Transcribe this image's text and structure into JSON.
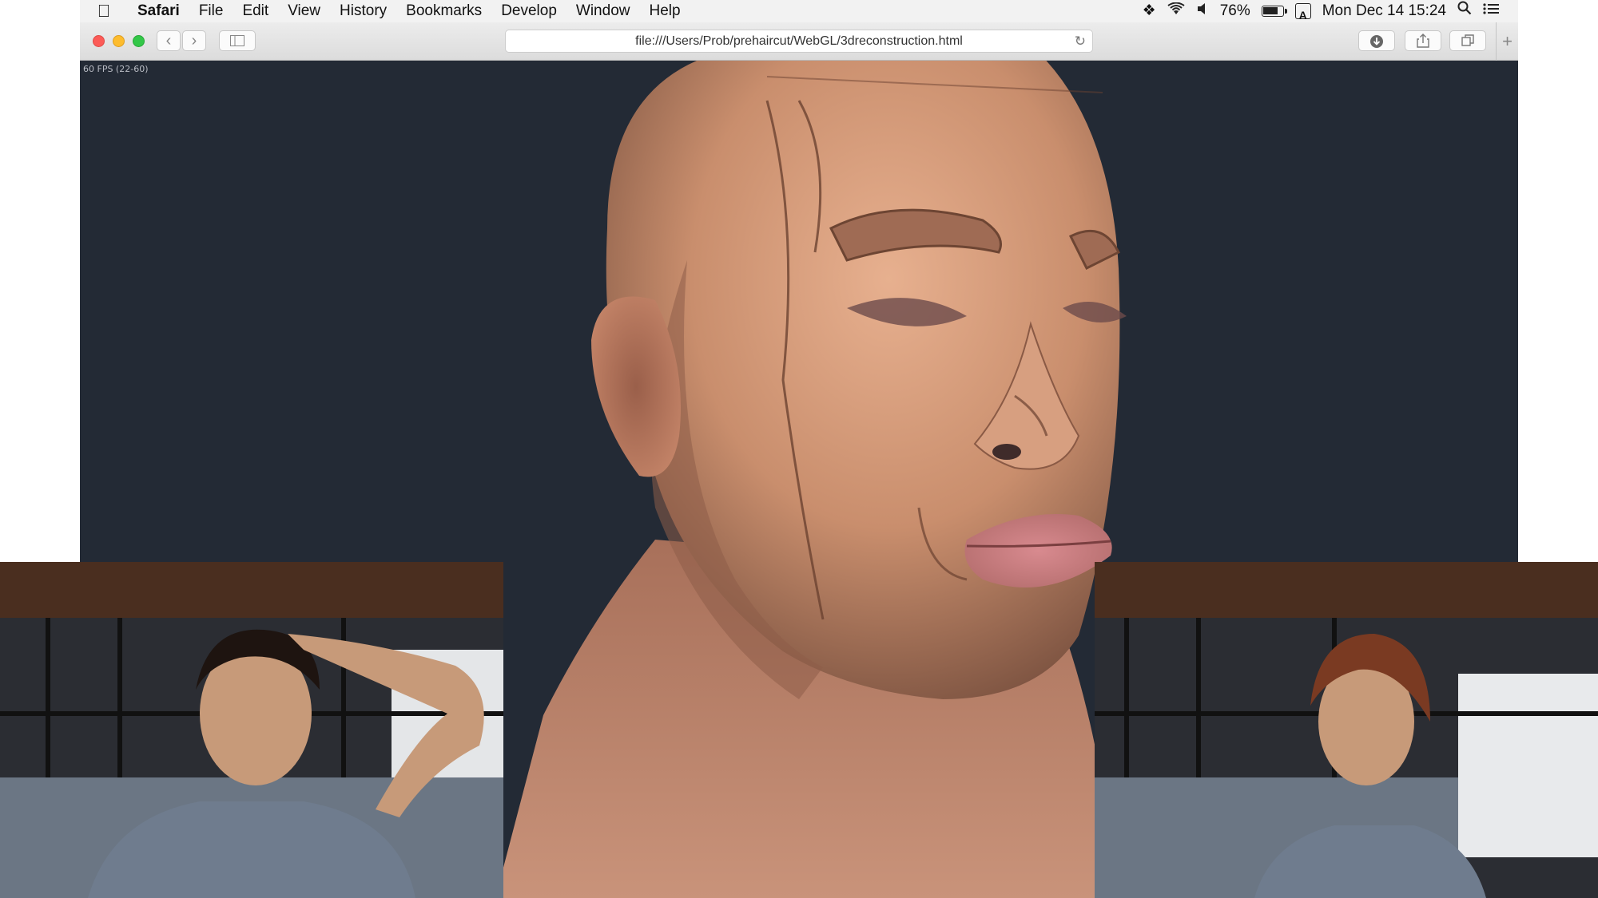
{
  "menubar": {
    "app_name": "Safari",
    "menus": [
      "File",
      "Edit",
      "View",
      "History",
      "Bookmarks",
      "Develop",
      "Window",
      "Help"
    ],
    "battery_percent": "76%",
    "input_source": "A",
    "clock": "Mon Dec 14  15:24"
  },
  "toolbar": {
    "url": "file:///Users/Prob/prehaircut/WebGL/3dreconstruction.html"
  },
  "viewport": {
    "fps_label": "60 FPS (22-60)",
    "background_color": "#232a35",
    "skin_color": "#c98e6d"
  }
}
